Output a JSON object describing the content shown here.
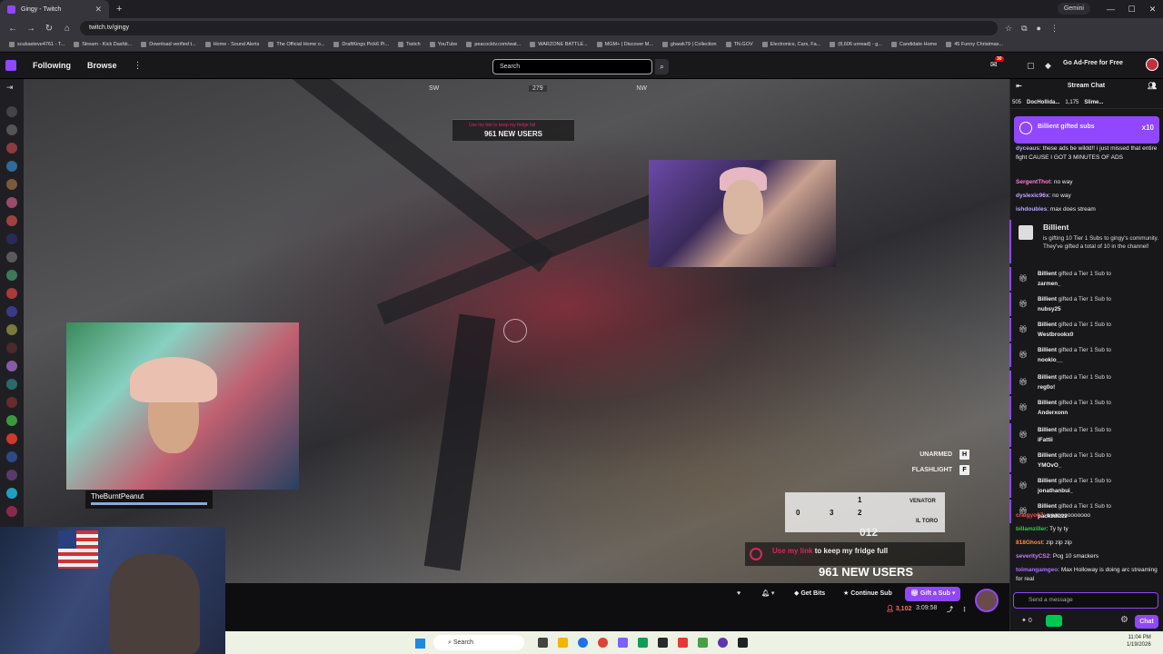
{
  "browser": {
    "tab_title": "Gingy - Twitch",
    "new_tab": "+",
    "url": "twitch.tv/gingy",
    "profile_label": "Gemini",
    "bookmarks": [
      "scubasteve4761 - T...",
      "Stream - Kick Dashb...",
      "Download verified t...",
      "Home - Sound Alerts",
      "The Official Home o...",
      "DraftKings Pick6 Pi...",
      "Twitch",
      "YouTube",
      "peacocktv.com/wat...",
      "WARZONE BATTLE...",
      "MGM+ | Discover M...",
      "ghawk79 | Collection",
      "TN.GOV",
      "Electronics, Cars, Fa...",
      "(8,606 unread) - g...",
      "Candidate Home",
      "45 Funny Christmas..."
    ]
  },
  "twitch_nav": {
    "following": "Following",
    "browse": "Browse",
    "search_placeholder": "Search",
    "notif_count": "30",
    "ad_free": "Go Ad-Free for Free"
  },
  "video": {
    "compass_left": "SW",
    "compass_deg": "279",
    "compass_right": "NW",
    "banner_small": "Use my link to keep my fridge full",
    "new_users_top": "961 NEW USERS",
    "nameplate": "TheBurntPeanut",
    "unarmed": "UNARMED",
    "unarmed_key": "H",
    "flashlight": "FLASHLIGHT",
    "flashlight_key": "F",
    "weapon_slot0": "0",
    "weapon_slot3": "3",
    "weapon_slot1": "1",
    "weapon_slot2": "2",
    "weapon1": "VENATOR",
    "weapon2": "IL TORO",
    "ammo": "012",
    "banner_link": "Use my link",
    "banner_rest": " to keep my fridge full",
    "new_users_bottom": "961 NEW USERS"
  },
  "underbar": {
    "get_bits": "Get Bits",
    "continue_sub": "Continue Sub",
    "gift_sub": "Gift a Sub",
    "viewers": "3,102",
    "uptime": "3:09:58"
  },
  "chat": {
    "title": "Stream Chat",
    "leaderboard": [
      {
        "rank": "505",
        "name": "DocHollida..."
      },
      {
        "rank": "",
        "name": "1,175"
      },
      {
        "rank": "",
        "name": "Slime..."
      }
    ],
    "gifted_banner": "Billient gifted subs",
    "gifted_count": "x10",
    "messages_top": [
      {
        "user": "dyceaus",
        "text": ": these ads be wildd!! i just missed that entire fight CAUSE I GOT 3 MINUTES OF ADS",
        "color": "#b8a8ff"
      },
      {
        "user": "SergentThot",
        "text": ": no way",
        "color": "#ff7ad8"
      },
      {
        "user": "dyslexic96x",
        "text": ": no way",
        "color": "#c7a6ff"
      },
      {
        "user": "ishdoubles",
        "text": ": max does stream",
        "color": "#b8a8ff"
      }
    ],
    "big_gift_name": "Billient",
    "big_gift_text": "is gifting 10 Tier 1 Subs to gingy's community. They've gifted a total of 10 in the channel!",
    "gift_lines": [
      {
        "from": "Billient",
        "mid": " gifted a Tier 1 Sub to ",
        "to": "zarmen_"
      },
      {
        "from": "Billient",
        "mid": " gifted a Tier 1 Sub to ",
        "to": "nubsy25"
      },
      {
        "from": "Billient",
        "mid": " gifted a Tier 1 Sub to ",
        "to": "Westbrookx0"
      },
      {
        "from": "Billient",
        "mid": " gifted a Tier 1 Sub to ",
        "to": "nookio__"
      },
      {
        "from": "Billient",
        "mid": " gifted a Tier 1 Sub to ",
        "to": "reg0o!"
      },
      {
        "from": "Billient",
        "mid": " gifted a Tier 1 Sub to ",
        "to": "Anderxonn"
      },
      {
        "from": "Billient",
        "mid": " gifted a Tier 1 Sub to ",
        "to": "iFattii"
      },
      {
        "from": "Billient",
        "mid": " gifted a Tier 1 Sub to ",
        "to": "YMOvO_"
      },
      {
        "from": "Billient",
        "mid": " gifted a Tier 1 Sub to ",
        "to": "jonathanbui_"
      },
      {
        "from": "Billient",
        "mid": " gifted a Tier 1 Sub to ",
        "to": "packzdizzz"
      }
    ],
    "messages_bottom": [
      {
        "user": "craigyo07",
        "text": ": woooooooooooo",
        "color": "#ff4d4d"
      },
      {
        "user": "billamziller",
        "text": ": Ty ty ty",
        "color": "#34c759"
      },
      {
        "user": "818Ghost",
        "text": ": zip zip zip",
        "color": "#ff8a3d"
      },
      {
        "user": "severityCS2",
        "text": ": Pog 10 smackers",
        "color": "#c77dff"
      },
      {
        "user": "tolmangamgeo",
        "text": ": Max Holloway is doing arc streaming for real",
        "color": "#b06cff"
      }
    ],
    "input_placeholder": "Send a message",
    "points": "0",
    "chat_button": "Chat"
  },
  "taskbar": {
    "search": "Search",
    "time": "11:04 PM",
    "date": "1/19/2026"
  }
}
